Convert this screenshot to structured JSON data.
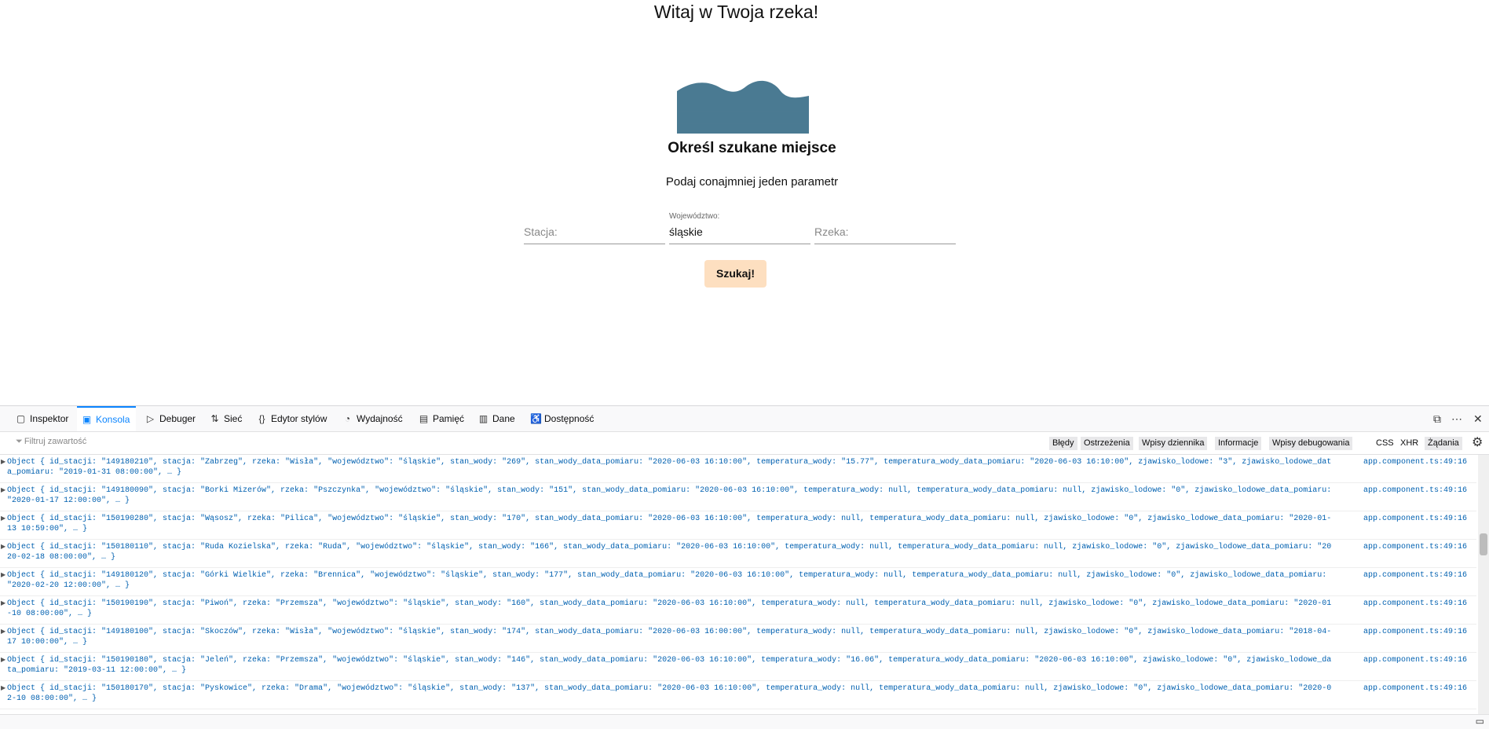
{
  "page": {
    "title": "Witaj w Twoja rzeka!",
    "subtitle": "Określ szukane miejsce",
    "hint": "Podaj conajmniej jeden parametr",
    "fields": {
      "stacja": {
        "placeholder": "Stacja:"
      },
      "wojewodztwo": {
        "label": "Województwo:",
        "value": "śląskie"
      },
      "rzeka": {
        "placeholder": "Rzeka:"
      }
    },
    "search_label": "Szukaj!",
    "accent_color": "#fddfc0",
    "river_color": "#4a7a92"
  },
  "devtools": {
    "tabs": [
      {
        "label": "Inspektor",
        "icon": "inspector-icon"
      },
      {
        "label": "Konsola",
        "icon": "console-icon"
      },
      {
        "label": "Debuger",
        "icon": "debugger-icon"
      },
      {
        "label": "Sieć",
        "icon": "network-icon"
      },
      {
        "label": "Edytor stylów",
        "icon": "style-editor-icon"
      },
      {
        "label": "Wydajność",
        "icon": "performance-icon"
      },
      {
        "label": "Pamięć",
        "icon": "memory-icon"
      },
      {
        "label": "Dane",
        "icon": "storage-icon"
      },
      {
        "label": "Dostępność",
        "icon": "accessibility-icon"
      }
    ],
    "active_tab": "Konsola",
    "filter_placeholder": "Filtruj zawartość",
    "filter_buttons": [
      "Błędy",
      "Ostrzeżenia",
      "Wpisy dziennika",
      "Informacje",
      "Wpisy debugowania"
    ],
    "type_buttons": [
      "CSS",
      "XHR",
      "Żądania"
    ],
    "rows": [
      {
        "msg": "Object { id_stacji: \"149180210\", stacja: \"Zabrzeg\", rzeka: \"Wisła\", \"województwo\": \"śląskie\", stan_wody: \"269\", stan_wody_data_pomiaru: \"2020-06-03 16:10:00\", temperatura_wody: \"15.77\", temperatura_wody_data_pomiaru: \"2020-06-03 16:10:00\", zjawisko_lodowe: \"3\", zjawisko_lodowe_data_pomiaru: \"2019-01-31 08:00:00\", … }",
        "src": "app.component.ts:49:16"
      },
      {
        "msg": "Object { id_stacji: \"149180090\", stacja: \"Borki Mizerów\", rzeka: \"Pszczynka\", \"województwo\": \"śląskie\", stan_wody: \"151\", stan_wody_data_pomiaru: \"2020-06-03 16:10:00\", temperatura_wody: null, temperatura_wody_data_pomiaru: null, zjawisko_lodowe: \"0\", zjawisko_lodowe_data_pomiaru: \"2020-01-17 12:00:00\", … }",
        "src": "app.component.ts:49:16"
      },
      {
        "msg": "Object { id_stacji: \"150190280\", stacja: \"Wąsosz\", rzeka: \"Pilica\", \"województwo\": \"śląskie\", stan_wody: \"170\", stan_wody_data_pomiaru: \"2020-06-03 16:10:00\", temperatura_wody: null, temperatura_wody_data_pomiaru: null, zjawisko_lodowe: \"0\", zjawisko_lodowe_data_pomiaru: \"2020-01-13 10:59:00\", … }",
        "src": "app.component.ts:49:16"
      },
      {
        "msg": "Object { id_stacji: \"150180110\", stacja: \"Ruda Kozielska\", rzeka: \"Ruda\", \"województwo\": \"śląskie\", stan_wody: \"166\", stan_wody_data_pomiaru: \"2020-06-03 16:10:00\", temperatura_wody: null, temperatura_wody_data_pomiaru: null, zjawisko_lodowe: \"0\", zjawisko_lodowe_data_pomiaru: \"2020-02-18 08:00:00\", … }",
        "src": "app.component.ts:49:16"
      },
      {
        "msg": "Object { id_stacji: \"149180120\", stacja: \"Górki Wielkie\", rzeka: \"Brennica\", \"województwo\": \"śląskie\", stan_wody: \"177\", stan_wody_data_pomiaru: \"2020-06-03 16:10:00\", temperatura_wody: null, temperatura_wody_data_pomiaru: null, zjawisko_lodowe: \"0\", zjawisko_lodowe_data_pomiaru: \"2020-02-20 12:00:00\", … }",
        "src": "app.component.ts:49:16"
      },
      {
        "msg": "Object { id_stacji: \"150190190\", stacja: \"Piwoń\", rzeka: \"Przemsza\", \"województwo\": \"śląskie\", stan_wody: \"160\", stan_wody_data_pomiaru: \"2020-06-03 16:10:00\", temperatura_wody: null, temperatura_wody_data_pomiaru: null, zjawisko_lodowe: \"0\", zjawisko_lodowe_data_pomiaru: \"2020-01-10 08:00:00\", … }",
        "src": "app.component.ts:49:16"
      },
      {
        "msg": "Object { id_stacji: \"149180100\", stacja: \"Skoczów\", rzeka: \"Wisła\", \"województwo\": \"śląskie\", stan_wody: \"174\", stan_wody_data_pomiaru: \"2020-06-03 16:00:00\", temperatura_wody: null, temperatura_wody_data_pomiaru: null, zjawisko_lodowe: \"0\", zjawisko_lodowe_data_pomiaru: \"2018-04-17 10:00:00\", … }",
        "src": "app.component.ts:49:16"
      },
      {
        "msg": "Object { id_stacji: \"150190180\", stacja: \"Jeleń\", rzeka: \"Przemsza\", \"województwo\": \"śląskie\", stan_wody: \"146\", stan_wody_data_pomiaru: \"2020-06-03 16:10:00\", temperatura_wody: \"16.06\", temperatura_wody_data_pomiaru: \"2020-06-03 16:10:00\", zjawisko_lodowe: \"0\", zjawisko_lodowe_data_pomiaru: \"2019-03-11 12:00:00\", … }",
        "src": "app.component.ts:49:16"
      },
      {
        "msg": "Object { id_stacji: \"150180170\", stacja: \"Pyskowice\", rzeka: \"Drama\", \"województwo\": \"śląskie\", stan_wody: \"137\", stan_wody_data_pomiaru: \"2020-06-03 16:10:00\", temperatura_wody: null, temperatura_wody_data_pomiaru: null, zjawisko_lodowe: \"0\", zjawisko_lodowe_data_pomiaru: \"2020-02-10 08:00:00\", … }",
        "src": "app.component.ts:49:16"
      }
    ]
  }
}
